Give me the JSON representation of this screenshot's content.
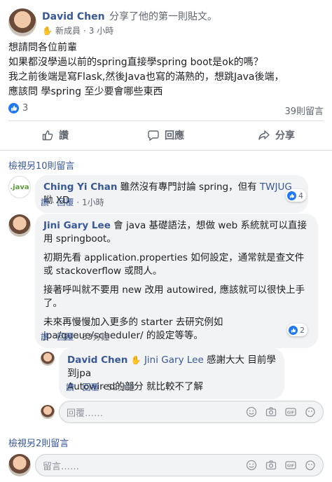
{
  "post": {
    "author": "David Chen",
    "action": "分享了他的第一則貼文。",
    "badge": "新成員",
    "time": "3 小時",
    "lines": [
      "想請問各位前輩",
      "如果都沒學過以前的spring直接學spring boot是ok的嗎？",
      "我之前後端是寫Flask,然後Java也寫的滿熟的，想跳Java後端，",
      "應該問 學spring 至少要會哪些東西"
    ],
    "like_count": "3",
    "comment_count": "39則留言"
  },
  "actions": {
    "like": "讚",
    "comment": "回應",
    "share": "分享"
  },
  "more_comments_top": "檢視另10則留言",
  "comments": [
    {
      "name": "Ching Yi Chan",
      "text_before": " 雖然沒有專門討論 spring，但有 ",
      "link": "TWJUG",
      "text_after": " 呦 XD",
      "like": "讚",
      "reply": "回覆",
      "time": "1小時",
      "reactions": "4",
      "avatar_text": ".java"
    },
    {
      "name": "Jini Gary Lee",
      "paragraphs": [
        " 會 java 基礎語法，想做 web 系統就可以直接用 springboot。",
        "初期先看 application.properties 如何設定，通常就是查文件或 stackoverflow 或問人。",
        "接著呼叫就不要用 new 改用 autowired, 應該就可以很快上手了。",
        "未來再慢慢加入更多的 starter 去研究例如 jpa/queue/scheduler/ 的設定等等。"
      ],
      "like": "讚",
      "reply": "回覆",
      "time": "53分鐘",
      "reactions": "2"
    }
  ],
  "reply": {
    "name": "David Chen",
    "mention": "Jini Gary Lee",
    "line1": " 感謝大大 目前學到jpa",
    "line2": "Autowired的部分 就比較不了解",
    "like": "讚",
    "reply": "回覆",
    "time": "52分鐘"
  },
  "reply_input_placeholder": "回覆……",
  "more_comments_bottom": "檢視另2則留言",
  "comment_input_placeholder": "留言……",
  "colors": {
    "link": "#385898",
    "like_blue": "#2078f4",
    "muted": "#606770"
  }
}
